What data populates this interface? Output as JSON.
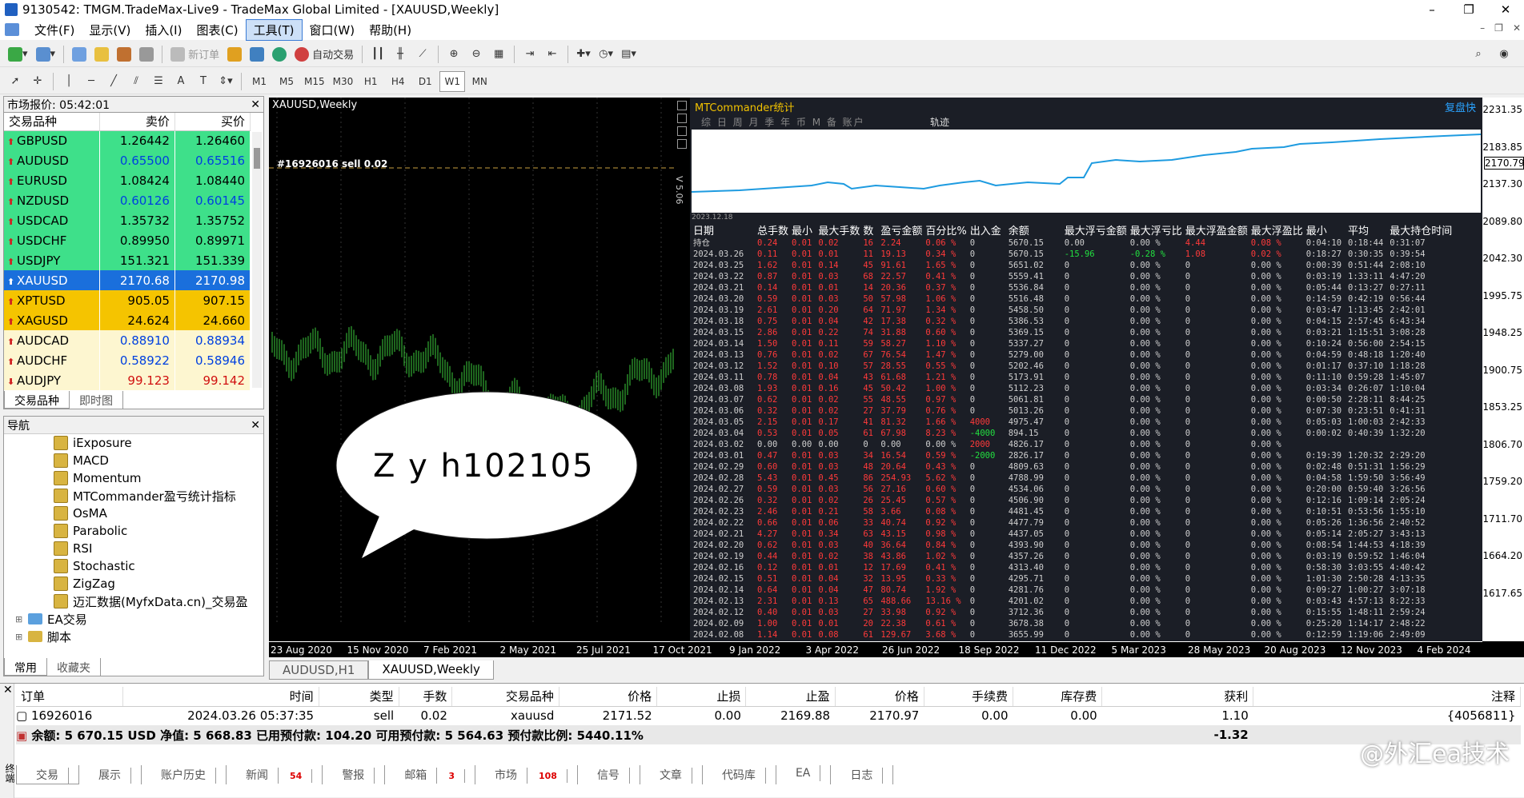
{
  "window": {
    "title": "9130542: TMGM.TradeMax-Live9 - TradeMax Global Limited - [XAUUSD,Weekly]"
  },
  "menu": [
    "文件(F)",
    "显示(V)",
    "插入(I)",
    "图表(C)",
    "工具(T)",
    "窗口(W)",
    "帮助(H)"
  ],
  "toolbar": {
    "new_order": "新订单",
    "auto_trading": "自动交易"
  },
  "timeframes": [
    "M1",
    "M5",
    "M15",
    "M30",
    "H1",
    "H4",
    "D1",
    "W1",
    "MN"
  ],
  "market_watch": {
    "header": "市场报价: 05:42:01",
    "col_symbol": "交易品种",
    "col_bid": "卖价",
    "col_ask": "买价",
    "rows": [
      {
        "symbol": "GBPUSD",
        "bid": "1.26442",
        "ask": "1.26460",
        "bg": "#3ee08a",
        "color": "#000"
      },
      {
        "symbol": "AUDUSD",
        "bid": "0.65500",
        "ask": "0.65516",
        "bg": "#3ee08a",
        "color": "#0040e0"
      },
      {
        "symbol": "EURUSD",
        "bid": "1.08424",
        "ask": "1.08440",
        "bg": "#3ee08a",
        "color": "#000"
      },
      {
        "symbol": "NZDUSD",
        "bid": "0.60126",
        "ask": "0.60145",
        "bg": "#3ee08a",
        "color": "#0040e0"
      },
      {
        "symbol": "USDCAD",
        "bid": "1.35732",
        "ask": "1.35752",
        "bg": "#3ee08a",
        "color": "#000"
      },
      {
        "symbol": "USDCHF",
        "bid": "0.89950",
        "ask": "0.89971",
        "bg": "#3ee08a",
        "color": "#000"
      },
      {
        "symbol": "USDJPY",
        "bid": "151.321",
        "ask": "151.339",
        "bg": "#3ee08a",
        "color": "#000"
      },
      {
        "symbol": "XAUUSD",
        "bid": "2170.68",
        "ask": "2170.98",
        "bg": "#1a6fdc",
        "color": "#fff"
      },
      {
        "symbol": "XPTUSD",
        "bid": "905.05",
        "ask": "907.15",
        "bg": "#f5c400",
        "color": "#000"
      },
      {
        "symbol": "XAGUSD",
        "bid": "24.624",
        "ask": "24.660",
        "bg": "#f5c400",
        "color": "#000"
      },
      {
        "symbol": "AUDCAD",
        "bid": "0.88910",
        "ask": "0.88934",
        "bg": "#fdf6d0",
        "color": "#0040e0"
      },
      {
        "symbol": "AUDCHF",
        "bid": "0.58922",
        "ask": "0.58946",
        "bg": "#fdf6d0",
        "color": "#0040e0"
      },
      {
        "symbol": "AUDJPY",
        "bid": "99.123",
        "ask": "99.142",
        "bg": "#fdf6d0",
        "color": "#d01010"
      }
    ],
    "tabs": [
      "交易品种",
      "即时图"
    ]
  },
  "navigator": {
    "header": "导航",
    "indicators": [
      "iExposure",
      "MACD",
      "Momentum",
      "MTCommander盈亏统计指标",
      "OsMA",
      "Parabolic",
      "RSI",
      "Stochastic",
      "ZigZag",
      "迈汇数据(MyfxData.cn)_交易盈"
    ],
    "folders": [
      "EA交易",
      "脚本"
    ],
    "tabs": [
      "常用",
      "收藏夹"
    ]
  },
  "chart": {
    "title": "XAUUSD,Weekly",
    "order_line_label": "#16926016 sell 0.02",
    "version_label": "V 5.06",
    "price_labels": [
      "2231.35",
      "2183.85",
      "2137.30",
      "2089.80",
      "2042.30",
      "1995.75",
      "1948.25",
      "1900.75",
      "1853.25",
      "1806.70",
      "1759.20",
      "1711.70",
      "1664.20",
      "1617.65"
    ],
    "current_price": "2170.79",
    "time_labels": [
      "23 Aug 2020",
      "15 Nov 2020",
      "7 Feb 2021",
      "2 May 2021",
      "25 Jul 2021",
      "17 Oct 2021",
      "9 Jan 2022",
      "3 Apr 2022",
      "26 Jun 2022",
      "18 Sep 2022",
      "11 Dec 2022",
      "5 Mar 2023",
      "28 May 2023",
      "20 Aug 2023",
      "12 Nov 2023",
      "4 Feb 2024"
    ],
    "bubble_text": "Z y h102105"
  },
  "mtc": {
    "title": "MTCommander统计",
    "right_label": "复盘快",
    "tabs": "综 日 周 月 季 年 币 M 备 账户",
    "track": "轨迹",
    "graph_date": "2023.12.18",
    "headers": [
      "日期",
      "总手数",
      "最小",
      "最大手数",
      "数",
      "盈亏金额",
      "百分比%",
      "出入金",
      "余额",
      "最大浮亏金额",
      "最大浮亏比",
      "最大浮盈金额",
      "最大浮盈比",
      "最小",
      "平均",
      "最大持仓时间"
    ],
    "rows": [
      [
        "持仓",
        "0.24",
        "0.01",
        "0.02",
        "16",
        "2.24",
        "0.06 %",
        "0",
        "5670.15",
        "0.00",
        "0.00 %",
        "4.44",
        "0.08 %",
        "0:04:10",
        "0:18:44",
        "0:31:07"
      ],
      [
        "2024.03.26",
        "0.11",
        "0.01",
        "0.01",
        "11",
        "19.13",
        "0.34 %",
        "0",
        "5670.15",
        "-15.96",
        "-0.28 %",
        "1.08",
        "0.02 %",
        "0:18:27",
        "0:30:35",
        "0:39:54"
      ],
      [
        "2024.03.25",
        "1.62",
        "0.01",
        "0.14",
        "45",
        "91.61",
        "1.65 %",
        "0",
        "5651.02",
        "0",
        "0.00 %",
        "0",
        "0.00 %",
        "0:00:39",
        "0:51:44",
        "2:08:10"
      ],
      [
        "2024.03.22",
        "0.87",
        "0.01",
        "0.03",
        "68",
        "22.57",
        "0.41 %",
        "0",
        "5559.41",
        "0",
        "0.00 %",
        "0",
        "0.00 %",
        "0:03:19",
        "1:33:11",
        "4:47:20"
      ],
      [
        "2024.03.21",
        "0.14",
        "0.01",
        "0.01",
        "14",
        "20.36",
        "0.37 %",
        "0",
        "5536.84",
        "0",
        "0.00 %",
        "0",
        "0.00 %",
        "0:05:44",
        "0:13:27",
        "0:27:11"
      ],
      [
        "2024.03.20",
        "0.59",
        "0.01",
        "0.03",
        "50",
        "57.98",
        "1.06 %",
        "0",
        "5516.48",
        "0",
        "0.00 %",
        "0",
        "0.00 %",
        "0:14:59",
        "0:42:19",
        "0:56:44"
      ],
      [
        "2024.03.19",
        "2.61",
        "0.01",
        "0.20",
        "64",
        "71.97",
        "1.34 %",
        "0",
        "5458.50",
        "0",
        "0.00 %",
        "0",
        "0.00 %",
        "0:03:47",
        "1:13:45",
        "2:42:01"
      ],
      [
        "2024.03.18",
        "0.75",
        "0.01",
        "0.04",
        "42",
        "17.38",
        "0.32 %",
        "0",
        "5386.53",
        "0",
        "0.00 %",
        "0",
        "0.00 %",
        "0:04:15",
        "2:57:45",
        "6:43:34"
      ],
      [
        "2024.03.15",
        "2.86",
        "0.01",
        "0.22",
        "74",
        "31.88",
        "0.60 %",
        "0",
        "5369.15",
        "0",
        "0.00 %",
        "0",
        "0.00 %",
        "0:03:21",
        "1:15:51",
        "3:08:28"
      ],
      [
        "2024.03.14",
        "1.50",
        "0.01",
        "0.11",
        "59",
        "58.27",
        "1.10 %",
        "0",
        "5337.27",
        "0",
        "0.00 %",
        "0",
        "0.00 %",
        "0:10:24",
        "0:56:00",
        "2:54:15"
      ],
      [
        "2024.03.13",
        "0.76",
        "0.01",
        "0.02",
        "67",
        "76.54",
        "1.47 %",
        "0",
        "5279.00",
        "0",
        "0.00 %",
        "0",
        "0.00 %",
        "0:04:59",
        "0:48:18",
        "1:20:40"
      ],
      [
        "2024.03.12",
        "1.52",
        "0.01",
        "0.10",
        "57",
        "28.55",
        "0.55 %",
        "0",
        "5202.46",
        "0",
        "0.00 %",
        "0",
        "0.00 %",
        "0:01:17",
        "0:37:10",
        "1:18:28"
      ],
      [
        "2024.03.11",
        "0.78",
        "0.01",
        "0.04",
        "43",
        "61.68",
        "1.21 %",
        "0",
        "5173.91",
        "0",
        "0.00 %",
        "0",
        "0.00 %",
        "0:11:10",
        "0:59:28",
        "1:45:07"
      ],
      [
        "2024.03.08",
        "1.93",
        "0.01",
        "0.16",
        "45",
        "50.42",
        "1.00 %",
        "0",
        "5112.23",
        "0",
        "0.00 %",
        "0",
        "0.00 %",
        "0:03:34",
        "0:26:07",
        "1:10:04"
      ],
      [
        "2024.03.07",
        "0.62",
        "0.01",
        "0.02",
        "55",
        "48.55",
        "0.97 %",
        "0",
        "5061.81",
        "0",
        "0.00 %",
        "0",
        "0.00 %",
        "0:00:50",
        "2:28:11",
        "8:44:25"
      ],
      [
        "2024.03.06",
        "0.32",
        "0.01",
        "0.02",
        "27",
        "37.79",
        "0.76 %",
        "0",
        "5013.26",
        "0",
        "0.00 %",
        "0",
        "0.00 %",
        "0:07:30",
        "0:23:51",
        "0:41:31"
      ],
      [
        "2024.03.05",
        "2.15",
        "0.01",
        "0.17",
        "41",
        "81.32",
        "1.66 %",
        "4000",
        "4975.47",
        "0",
        "0.00 %",
        "0",
        "0.00 %",
        "0:05:03",
        "1:00:03",
        "2:42:33"
      ],
      [
        "2024.03.04",
        "0.53",
        "0.01",
        "0.05",
        "61",
        "67.98",
        "8.23 %",
        "-4000",
        "894.15",
        "0",
        "0.00 %",
        "0",
        "0.00 %",
        "0:00:02",
        "0:40:39",
        "1:32:20"
      ],
      [
        "2024.03.02",
        "0.00",
        "0.00",
        "0.00",
        "0",
        "0.00",
        "0.00 %",
        "2000",
        "4826.17",
        "0",
        "0.00 %",
        "0",
        "0.00 %",
        "",
        "",
        ""
      ],
      [
        "2024.03.01",
        "0.47",
        "0.01",
        "0.03",
        "34",
        "16.54",
        "0.59 %",
        "-2000",
        "2826.17",
        "0",
        "0.00 %",
        "0",
        "0.00 %",
        "0:19:39",
        "1:20:32",
        "2:29:20"
      ],
      [
        "2024.02.29",
        "0.60",
        "0.01",
        "0.03",
        "48",
        "20.64",
        "0.43 %",
        "0",
        "4809.63",
        "0",
        "0.00 %",
        "0",
        "0.00 %",
        "0:02:48",
        "0:51:31",
        "1:56:29"
      ],
      [
        "2024.02.28",
        "5.43",
        "0.01",
        "0.45",
        "86",
        "254.93",
        "5.62 %",
        "0",
        "4788.99",
        "0",
        "0.00 %",
        "0",
        "0.00 %",
        "0:04:58",
        "1:59:50",
        "3:56:49"
      ],
      [
        "2024.02.27",
        "0.59",
        "0.01",
        "0.03",
        "56",
        "27.16",
        "0.60 %",
        "0",
        "4534.06",
        "0",
        "0.00 %",
        "0",
        "0.00 %",
        "0:20:00",
        "0:59:40",
        "3:26:56"
      ],
      [
        "2024.02.26",
        "0.32",
        "0.01",
        "0.02",
        "26",
        "25.45",
        "0.57 %",
        "0",
        "4506.90",
        "0",
        "0.00 %",
        "0",
        "0.00 %",
        "0:12:16",
        "1:09:14",
        "2:05:24"
      ],
      [
        "2024.02.23",
        "2.46",
        "0.01",
        "0.21",
        "58",
        "3.66",
        "0.08 %",
        "0",
        "4481.45",
        "0",
        "0.00 %",
        "0",
        "0.00 %",
        "0:10:51",
        "0:53:56",
        "1:55:10"
      ],
      [
        "2024.02.22",
        "0.66",
        "0.01",
        "0.06",
        "33",
        "40.74",
        "0.92 %",
        "0",
        "4477.79",
        "0",
        "0.00 %",
        "0",
        "0.00 %",
        "0:05:26",
        "1:36:56",
        "2:40:52"
      ],
      [
        "2024.02.21",
        "4.27",
        "0.01",
        "0.34",
        "63",
        "43.15",
        "0.98 %",
        "0",
        "4437.05",
        "0",
        "0.00 %",
        "0",
        "0.00 %",
        "0:05:14",
        "2:05:27",
        "3:43:13"
      ],
      [
        "2024.02.20",
        "0.62",
        "0.01",
        "0.03",
        "40",
        "36.64",
        "0.84 %",
        "0",
        "4393.90",
        "0",
        "0.00 %",
        "0",
        "0.00 %",
        "0:08:54",
        "1:44:53",
        "4:18:39"
      ],
      [
        "2024.02.19",
        "0.44",
        "0.01",
        "0.02",
        "38",
        "43.86",
        "1.02 %",
        "0",
        "4357.26",
        "0",
        "0.00 %",
        "0",
        "0.00 %",
        "0:03:19",
        "0:59:52",
        "1:46:04"
      ],
      [
        "2024.02.16",
        "0.12",
        "0.01",
        "0.01",
        "12",
        "17.69",
        "0.41 %",
        "0",
        "4313.40",
        "0",
        "0.00 %",
        "0",
        "0.00 %",
        "0:58:30",
        "3:03:55",
        "4:40:42"
      ],
      [
        "2024.02.15",
        "0.51",
        "0.01",
        "0.04",
        "32",
        "13.95",
        "0.33 %",
        "0",
        "4295.71",
        "0",
        "0.00 %",
        "0",
        "0.00 %",
        "1:01:30",
        "2:50:28",
        "4:13:35"
      ],
      [
        "2024.02.14",
        "0.64",
        "0.01",
        "0.04",
        "47",
        "80.74",
        "1.92 %",
        "0",
        "4281.76",
        "0",
        "0.00 %",
        "0",
        "0.00 %",
        "0:09:27",
        "1:00:27",
        "3:07:18"
      ],
      [
        "2024.02.13",
        "2.31",
        "0.01",
        "0.13",
        "65",
        "488.66",
        "13.16 %",
        "0",
        "4201.02",
        "0",
        "0.00 %",
        "0",
        "0.00 %",
        "0:03:43",
        "4:57:13",
        "8:22:33"
      ],
      [
        "2024.02.12",
        "0.40",
        "0.01",
        "0.03",
        "27",
        "33.98",
        "0.92 %",
        "0",
        "3712.36",
        "0",
        "0.00 %",
        "0",
        "0.00 %",
        "0:15:55",
        "1:48:11",
        "2:59:24"
      ],
      [
        "2024.02.09",
        "1.00",
        "0.01",
        "0.01",
        "20",
        "22.38",
        "0.61 %",
        "0",
        "3678.38",
        "0",
        "0.00 %",
        "0",
        "0.00 %",
        "0:25:20",
        "1:14:17",
        "2:48:22"
      ],
      [
        "2024.02.08",
        "1.14",
        "0.01",
        "0.08",
        "61",
        "129.67",
        "3.68 %",
        "0",
        "3655.99",
        "0",
        "0.00 %",
        "0",
        "0.00 %",
        "0:12:59",
        "1:19:06",
        "2:49:09"
      ]
    ]
  },
  "chart_tabs": [
    "AUDUSD,H1",
    "XAUUSD,Weekly"
  ],
  "terminal": {
    "headers": [
      "订单",
      "时间",
      "类型",
      "手数",
      "交易品种",
      "价格",
      "止损",
      "止盈",
      "价格",
      "手续费",
      "库存费",
      "获利",
      "注释"
    ],
    "order": [
      "16926016",
      "2024.03.26 05:37:35",
      "sell",
      "0.02",
      "xauusd",
      "2171.52",
      "0.00",
      "2169.88",
      "2170.97",
      "0.00",
      "0.00",
      "1.10",
      "{4056811}"
    ],
    "balance_line": "余额: 5 670.15 USD  净值: 5 668.83  已用预付款: 104.20  可用预付款: 5 564.63  预付款比例: 5440.11%",
    "balance_profit": "-1.32",
    "side_label": "终端",
    "tabs": [
      {
        "label": "交易",
        "badge": ""
      },
      {
        "label": "展示",
        "badge": ""
      },
      {
        "label": "账户历史",
        "badge": ""
      },
      {
        "label": "新闻",
        "badge": "54"
      },
      {
        "label": "警报",
        "badge": ""
      },
      {
        "label": "邮箱",
        "badge": "3"
      },
      {
        "label": "市场",
        "badge": "108"
      },
      {
        "label": "信号",
        "badge": ""
      },
      {
        "label": "文章",
        "badge": ""
      },
      {
        "label": "代码库",
        "badge": ""
      },
      {
        "label": "EA",
        "badge": ""
      },
      {
        "label": "日志",
        "badge": ""
      }
    ]
  },
  "watermark": "@外汇ea技术"
}
